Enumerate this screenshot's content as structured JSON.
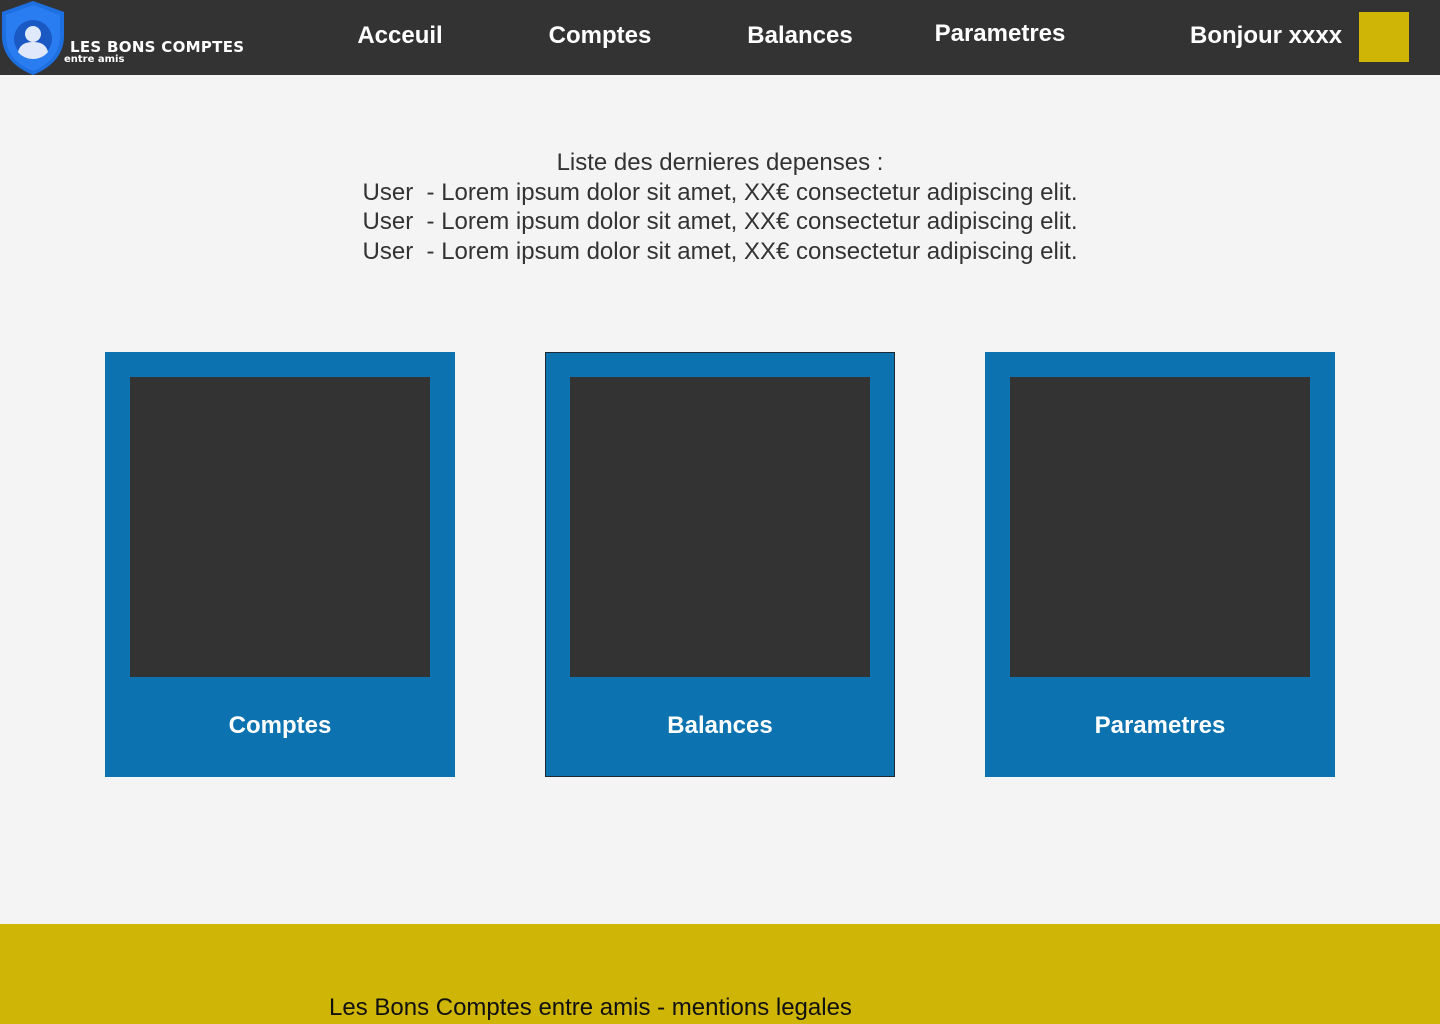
{
  "colors": {
    "header_bg": "#333333",
    "page_bg": "#f4f4f4",
    "card_bg": "#0c73b0",
    "card_image_bg": "#333333",
    "accent_yellow": "#cfb505",
    "logo_blue": "#1e6fe0"
  },
  "header": {
    "logo": {
      "icon": "shield-user-icon",
      "title": "LES BONS COMPTES",
      "subtitle": "entre amis"
    },
    "nav": {
      "accueil": "Acceuil",
      "comptes": "Comptes",
      "balances": "Balances",
      "parametres": "Parametres"
    },
    "greeting": "Bonjour xxxx",
    "avatar": "user-avatar"
  },
  "expenses": {
    "heading": "Liste des dernieres depenses :",
    "items": [
      {
        "user": "User",
        "text": "- Lorem ipsum dolor sit amet, XX€ consectetur adipiscing elit."
      },
      {
        "user": "User",
        "text": "- Lorem ipsum dolor sit amet, XX€ consectetur adipiscing elit."
      },
      {
        "user": "User",
        "text": "- Lorem ipsum dolor sit amet, XX€ consectetur adipiscing elit."
      }
    ]
  },
  "cards": [
    {
      "label": "Comptes",
      "image": "image-placeholder"
    },
    {
      "label": "Balances",
      "image": "image-placeholder"
    },
    {
      "label": "Parametres",
      "image": "image-placeholder"
    }
  ],
  "footer": {
    "text": "Les Bons Comptes entre amis - mentions legales"
  }
}
